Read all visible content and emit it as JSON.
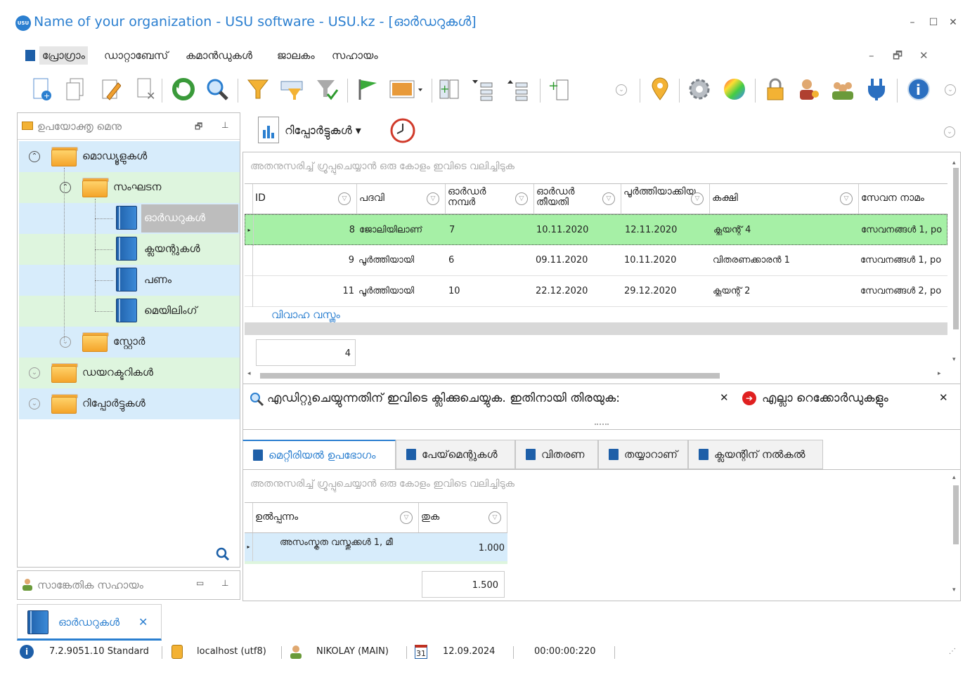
{
  "window": {
    "logo_text": "USU",
    "title": "Name of your organization - USU software - USU.kz - [ഓർഡറുകൾ]",
    "minimize": "–",
    "maximize": "☐",
    "close": "✕"
  },
  "menu": {
    "items": [
      "പ്രോഗ്രാം",
      "ഡാറ്റാബേസ്",
      "കമാൻഡുകൾ",
      "ജാലകം",
      "സഹായം"
    ],
    "right_controls": [
      "–",
      "🗗",
      "✕"
    ]
  },
  "left_panel": {
    "title": "ഉപയോക്തൃ മെനു",
    "tree": [
      {
        "label": "മൊഡ്യൂളുകൾ",
        "type": "folder",
        "level": 0,
        "expanded": true
      },
      {
        "label": "സംഘടന",
        "type": "folder",
        "level": 1,
        "expanded": true
      },
      {
        "label": "ഓർഡറുകൾ",
        "type": "book",
        "level": 2,
        "selected": true
      },
      {
        "label": "ക്ലയന്റുകൾ",
        "type": "book",
        "level": 2
      },
      {
        "label": "പണം",
        "type": "book",
        "level": 2
      },
      {
        "label": "മെയിലിംഗ്",
        "type": "book",
        "level": 2
      },
      {
        "label": "സ്റ്റോർ",
        "type": "folder",
        "level": 1,
        "expanded": false
      },
      {
        "label": "ഡയറക്ടറികൾ",
        "type": "folder",
        "level": 0,
        "expanded": false
      },
      {
        "label": "റിപ്പോർട്ടുകൾ",
        "type": "folder",
        "level": 0,
        "expanded": false
      }
    ],
    "support_title": "സാങ്കേതിക സഹായം"
  },
  "reports_bar": {
    "label": "റിപ്പോർട്ടുകൾ"
  },
  "grid": {
    "group_hint": "അതനുസരിച്ച് ഗ്രൂപ്പുചെയ്യാൻ ഒരു കോളം ഇവിടെ വലിച്ചിടുക",
    "columns": [
      "ID",
      "പദവി",
      "ഓർഡർ നമ്പർ",
      "ഓർഡർ തീയതി",
      "പൂർത്തിയാക്കിയ",
      "കക്ഷി",
      "സേവന നാമം"
    ],
    "rows": [
      {
        "id": "8",
        "status": "ജോലിയിലാണ്",
        "number": "7",
        "date": "10.11.2020",
        "done": "12.11.2020",
        "client": "ക്ലയന്റ് 4",
        "service": "സേവനങ്ങൾ 1, po"
      },
      {
        "id": "9",
        "status": "പൂർത്തിയായി",
        "number": "6",
        "date": "09.11.2020",
        "done": "10.11.2020",
        "client": "വിതരണക്കാരൻ 1",
        "service": "സേവനങ്ങൾ 1, po"
      },
      {
        "id": "11",
        "status": "പൂർത്തിയായി",
        "number": "10",
        "date": "22.12.2020",
        "done": "29.12.2020",
        "client": "ക്ലയന്റ് 2",
        "service": "സേവനങ്ങൾ 2, po"
      }
    ],
    "group_label": "വിവാഹ വസ്ത്രം",
    "total": "4"
  },
  "filter_bar": {
    "edit_hint": "എഡിറ്റുചെയ്യുന്നതിന് ഇവിടെ ക്ലിക്കുചെയ്യുക. ഇതിനായി തിരയുക:",
    "all_records": "എല്ലാ റെക്കോർഡുകളും"
  },
  "tabs": [
    "മെറ്റീരിയൽ ഉപഭോഗം",
    "പേയ്‌മെന്റുകൾ",
    "വിതരണ",
    "തയ്യാറാണ്",
    "ക്ലയന്റിന് നൽകൽ"
  ],
  "subgrid": {
    "group_hint": "അതനുസരിച്ച് ഗ്രൂപ്പുചെയ്യാൻ ഒരു കോളം ഇവിടെ വലിച്ചിടുക",
    "columns": [
      "ഉൽപ്പന്നം",
      "തുക"
    ],
    "rows": [
      {
        "product": "അസംസ്കൃത വസ്തുക്കൾ 1, മീ",
        "amount": "1.000"
      }
    ],
    "total": "1.500"
  },
  "taskbar": {
    "open_tab": "ഓർഡറുകൾ"
  },
  "status": {
    "version": "7.2.9051.10 Standard",
    "db": "localhost (utf8)",
    "user": "NIKOLAY (MAIN)",
    "date": "12.09.2024",
    "calendar_day": "31",
    "timer": "00:00:00:220"
  },
  "colors": {
    "accent": "#2b7fd0",
    "tree_blue": "#d7ecfb",
    "tree_green": "#def5de",
    "selected_row": "#a6f0a6"
  }
}
